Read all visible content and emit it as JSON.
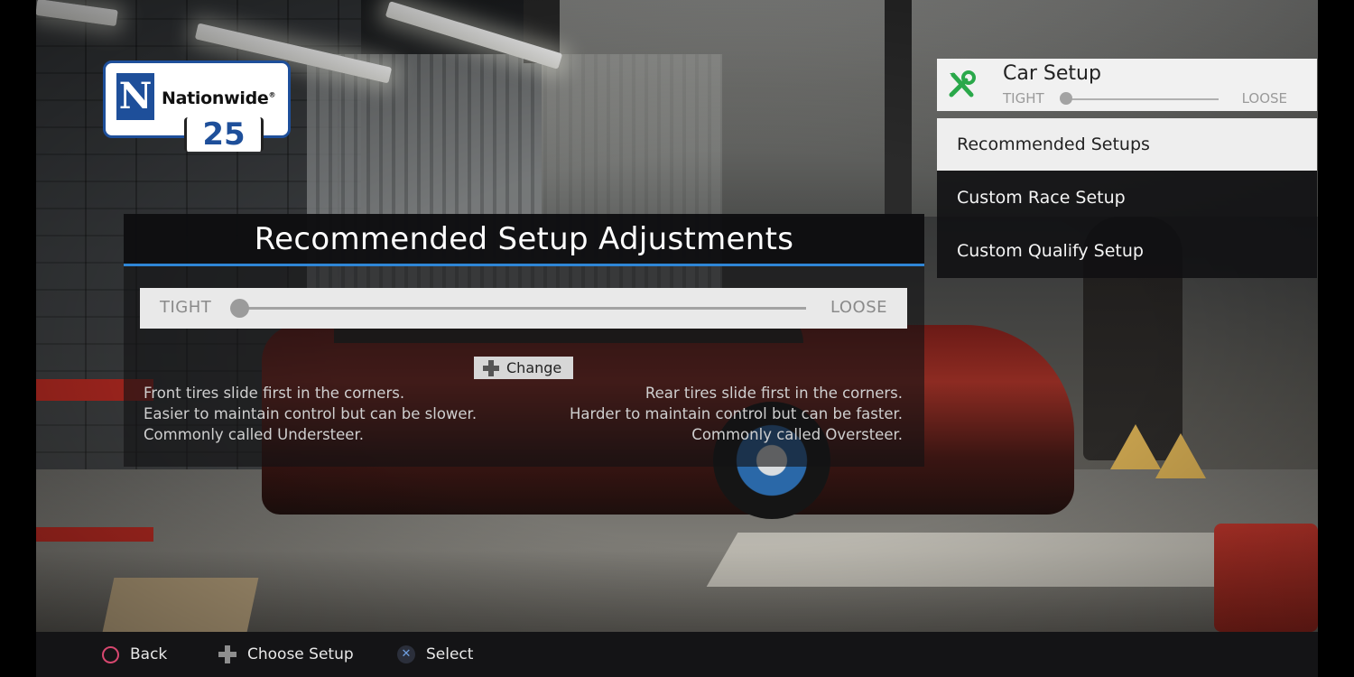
{
  "sponsor": {
    "brand": "Nationwide",
    "trademark": "®",
    "logo_letter": "N",
    "car_number": "25"
  },
  "panel": {
    "title": "Recommended Setup Adjustments",
    "balance": {
      "tight_label": "TIGHT",
      "loose_label": "LOOSE",
      "value_fraction": 0.0
    },
    "change_label": "Change",
    "tight_desc": [
      "Front tires slide first in the corners.",
      "Easier to maintain control but can be slower.",
      "Commonly called Understeer."
    ],
    "loose_desc": [
      "Rear tires slide first in the corners.",
      "Harder to maintain control but can be faster.",
      "Commonly called Oversteer."
    ]
  },
  "car_setup": {
    "title": "Car Setup",
    "tight_label": "TIGHT",
    "loose_label": "LOOSE",
    "value_fraction": 0.0,
    "items": [
      {
        "label": "Recommended Setups",
        "selected": true
      },
      {
        "label": "Custom Race Setup",
        "selected": false
      },
      {
        "label": "Custom Qualify Setup",
        "selected": false
      }
    ]
  },
  "hints": {
    "back": "Back",
    "choose_setup": "Choose Setup",
    "select": "Select",
    "cross_glyph": "✕"
  },
  "colors": {
    "accent_blue": "#2f86d6",
    "sponsor_blue": "#1e4f9a",
    "wrench_green": "#2aa84a",
    "circle_button": "#d7476f"
  }
}
